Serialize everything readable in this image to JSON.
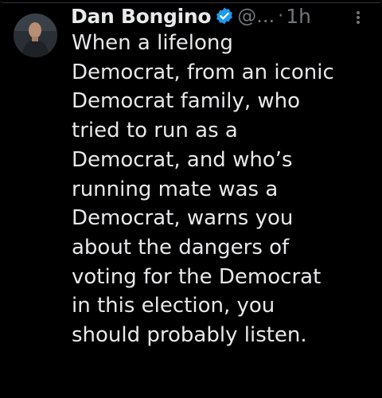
{
  "tweet": {
    "author_name": "Dan Bongino",
    "handle": "@...",
    "separator": "·",
    "time": "1h",
    "lines": [
      "When a lifelong",
      "Democrat, from an iconic",
      "Democrat family, who",
      "tried to run as a",
      "Democrat, and who’s",
      "running mate was a",
      "Democrat, warns you",
      "about the dangers of",
      "voting for the Democrat",
      "in this election, you",
      "should probably listen."
    ],
    "verified_icon": "verified-badge-icon",
    "more_icon": "more-vertical-icon"
  },
  "colors": {
    "background": "#000000",
    "text_primary": "#e7e9ea",
    "text_secondary": "#71767b",
    "verified_blue": "#1d9bf0"
  }
}
